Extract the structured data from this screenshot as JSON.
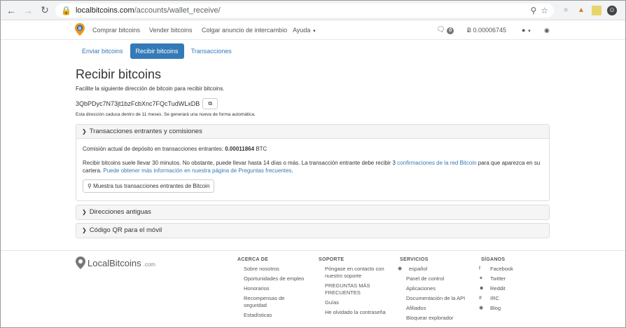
{
  "browser": {
    "url_host": "localbitcoins.com",
    "url_path": "/accounts/wallet_receive/"
  },
  "nav": {
    "buy": "Comprar bitcoins",
    "sell": "Vender bitcoins",
    "post_ad": "Colgar anuncio de intercambio",
    "help": "Ayuda",
    "messages_count": "0",
    "balance": "Ƀ 0.00006745"
  },
  "tabs": [
    "Enviar bitcoins",
    "Recibir bitcoins",
    "Transacciones"
  ],
  "page": {
    "title": "Recibir bitcoins",
    "subtitle": "Facilite la siguiente dirección de bitcoin para recibir bitcoins.",
    "address": "3QbPDyc7N73jt1bzFcbXnc7FQcTudWLxDB",
    "expiry_note": "Esta dirección caduca dentro de 11 meses. Se generará una nueva de forma automática."
  },
  "panel_incoming": {
    "header": "Transacciones entrantes y comisiones",
    "fee_label": "Comisión actual de depósito en transacciones entrantes:",
    "fee_value": "0.00011864",
    "fee_unit": "BTC",
    "info_text": "Recibir bitcoins suele llevar 30 minutos. No obstante, puede llevar hasta 14 días o más. La transacción entrante debe recibir 3",
    "info_link1": "confirmaciones de la red Bitcoin",
    "info_text2": "para que aparezca en su cartera.",
    "info_link2": "Puede obtener más información en nuestra página de Preguntas frecuentes",
    "button": "Muestra tus transacciones entrantes de Bitcoin"
  },
  "panel_old": {
    "header": "Direcciones antiguas"
  },
  "panel_qr": {
    "header": "Código QR para el móvil"
  },
  "footer": {
    "logo": "LocalBitcoins",
    "logo_suffix": ".com",
    "about": {
      "title": "ACERCA DE",
      "items": [
        "Sobre nosotros",
        "Oportunidades de empleo",
        "Honorarios",
        "Recompensas de seguridad",
        "Estadísticas"
      ]
    },
    "support": {
      "title": "SOPORTE",
      "items": [
        "Póngase en contacto con nuestro soporte",
        "PREGUNTAS MÁS FRECUENTES",
        "Guías",
        "He olvidado la contraseña"
      ]
    },
    "services": {
      "title": "SERVICIOS",
      "items": [
        "español",
        "Panel de control",
        "Aplicaciones",
        "Documentación de la API",
        "Afiliados",
        "Bloquear explorador"
      ]
    },
    "follow": {
      "title": "SÍGANOS",
      "items": [
        "Facebook",
        "Twitter",
        "Reddit",
        "IRC",
        "Blog"
      ]
    }
  },
  "colors": {
    "accent": "#337ab7",
    "panel_header": "#f5f5f5"
  }
}
